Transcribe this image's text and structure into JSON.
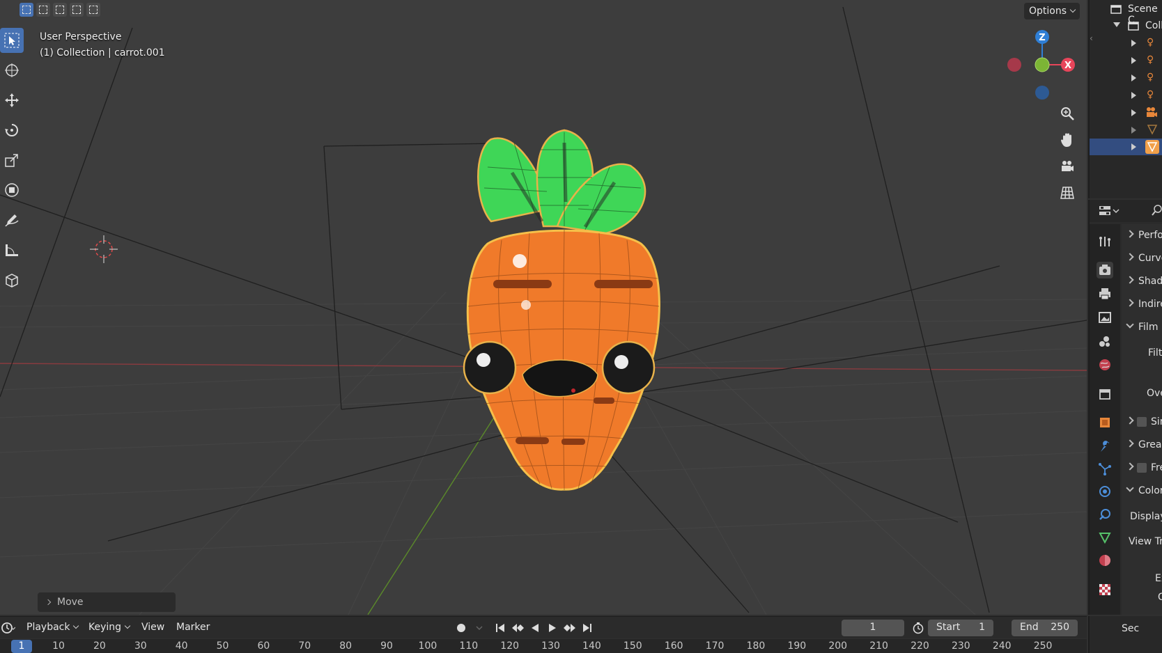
{
  "viewport": {
    "view_name": "User Perspective",
    "collection_object": "(1) Collection | carrot.001",
    "options_label": "Options",
    "gizmo_axes": [
      "Z",
      "X"
    ],
    "last_operator": "Move"
  },
  "outliner": {
    "header_label": "Scene C",
    "collection_label": "Coll"
  },
  "properties": {
    "panels": [
      {
        "label": "Perfor",
        "state": "collapsed"
      },
      {
        "label": "Curve",
        "state": "collapsed"
      },
      {
        "label": "Shade",
        "state": "collapsed"
      },
      {
        "label": "Indire",
        "state": "collapsed"
      },
      {
        "label": "Film",
        "state": "expanded"
      },
      {
        "label": "Filte",
        "state": "field"
      },
      {
        "label": "Ove",
        "state": "field"
      },
      {
        "label": "Sin",
        "state": "checkbox"
      },
      {
        "label": "Greas",
        "state": "collapsed"
      },
      {
        "label": "Fre",
        "state": "checkbox"
      },
      {
        "label": "Color",
        "state": "expanded"
      },
      {
        "label": "Display",
        "state": "field"
      },
      {
        "label": "View Tra",
        "state": "field"
      },
      {
        "label": "Ex",
        "state": "field"
      },
      {
        "label": "G",
        "state": "field"
      },
      {
        "label": "Sec",
        "state": "field"
      }
    ]
  },
  "timeline": {
    "menus": [
      "Playback",
      "Keying",
      "View",
      "Marker"
    ],
    "current_frame": "1",
    "start_label": "Start",
    "start_value": "1",
    "end_label": "End",
    "end_value": "250",
    "ruler_current": "1",
    "ruler_ticks": [
      "10",
      "20",
      "30",
      "40",
      "50",
      "60",
      "70",
      "80",
      "90",
      "100",
      "110",
      "120",
      "130",
      "140",
      "150",
      "160",
      "170",
      "180",
      "190",
      "200",
      "210",
      "220",
      "230",
      "240",
      "250"
    ]
  },
  "colors": {
    "accent": "#4772b3",
    "carrot_orange": "#f07a2a",
    "leaf_green": "#3fd657",
    "axis_x": "#e8455a",
    "axis_y": "#7cb535",
    "axis_z": "#2f7fd6",
    "background": "#3d3d3d"
  }
}
